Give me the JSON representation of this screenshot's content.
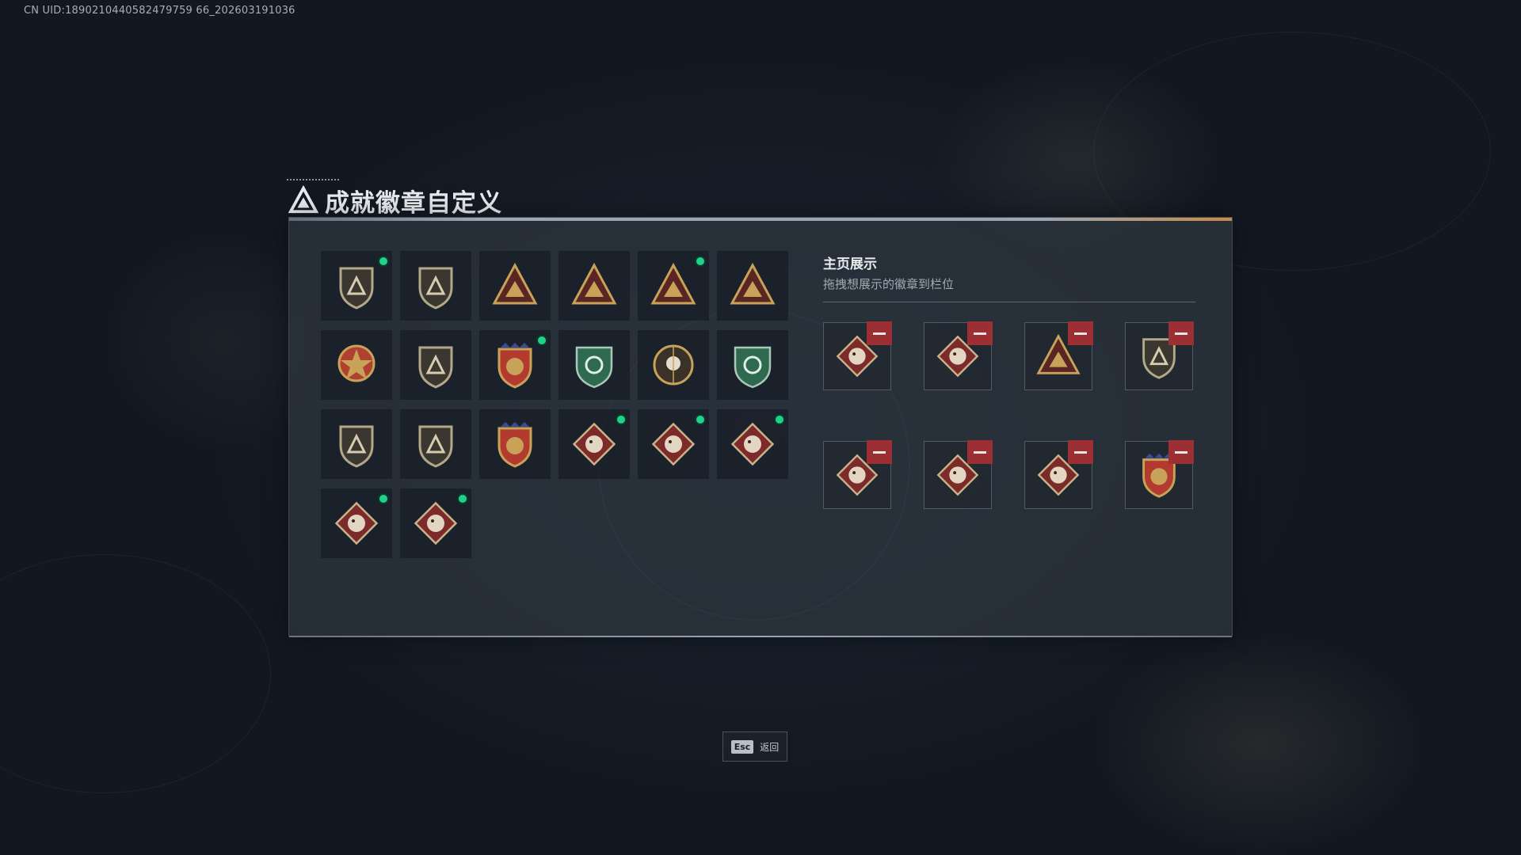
{
  "header": {
    "uid_text": "CN UID:1890210440582479759⁠ 66_202603191036"
  },
  "window": {
    "title": "成就徽章自定义",
    "title_icon": "triangle-emblem-icon"
  },
  "badge_collection": {
    "items": [
      {
        "icon": "shield-triangle-badge-icon",
        "new": true
      },
      {
        "icon": "helicopter-shield-badge-icon",
        "new": false
      },
      {
        "icon": "boat-triangle-badge-icon",
        "new": false
      },
      {
        "icon": "number-one-triangle-badge-icon",
        "new": false
      },
      {
        "icon": "laurel-triangle-badge-icon",
        "new": true
      },
      {
        "icon": "soldiers-triangle-badge-icon",
        "new": false
      },
      {
        "icon": "star-medal-badge-icon",
        "new": false
      },
      {
        "icon": "eagle-shield-badge-icon",
        "new": false
      },
      {
        "icon": "crest-stars-badge-icon",
        "new": true
      },
      {
        "icon": "green-gem-shield-badge-icon",
        "new": false
      },
      {
        "icon": "skull-crosshair-badge-icon",
        "new": false
      },
      {
        "icon": "green-target-shield-badge-icon",
        "new": false
      },
      {
        "icon": "rifle-shield-badge-icon",
        "new": false
      },
      {
        "icon": "rifle-shield-badge-icon",
        "new": false
      },
      {
        "icon": "anchor-crest-badge-icon",
        "new": false
      },
      {
        "icon": "wolf-diamond-badge-icon",
        "new": true
      },
      {
        "icon": "dragon-diamond-badge-icon",
        "new": true
      },
      {
        "icon": "runner-diamond-badge-icon",
        "new": true
      },
      {
        "icon": "horse-diamond-badge-icon",
        "new": true
      },
      {
        "icon": "medic-diamond-badge-icon",
        "new": true
      }
    ]
  },
  "showcase": {
    "title": "主页展示",
    "subtitle": "拖拽想展示的徽章到栏位",
    "slots": [
      {
        "icon": "dragon-diamond-badge-icon"
      },
      {
        "icon": "runner-diamond-badge-icon"
      },
      {
        "icon": "laurel-triangle-badge-icon"
      },
      {
        "icon": "shield-triangle-badge-icon"
      },
      {
        "icon": "wolf-diamond-badge-icon"
      },
      {
        "icon": "horse-diamond-badge-icon"
      },
      {
        "icon": "medic-diamond-badge-icon"
      },
      {
        "icon": "crest-stars-badge-icon"
      }
    ]
  },
  "footer": {
    "esc_key": "Esc",
    "back_label": "返回"
  },
  "colors": {
    "new_indicator": "#1fd28a",
    "remove_button": "#9c2f33",
    "gold": "#c9a25a",
    "badge_red": "#7d2a2a",
    "badge_green": "#2f6a50"
  }
}
